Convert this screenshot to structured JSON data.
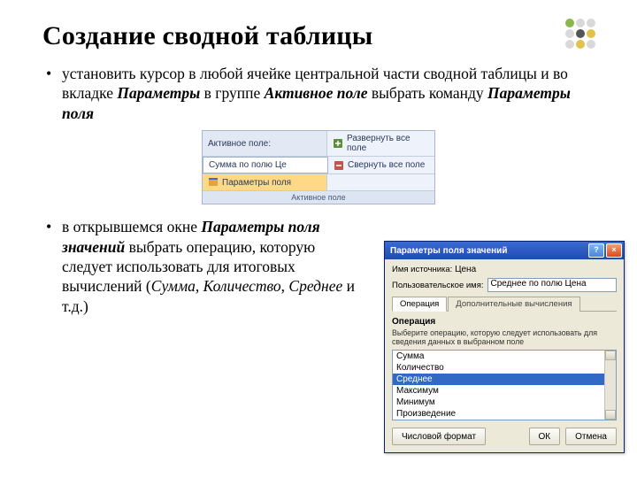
{
  "title": "Создание сводной таблицы",
  "bullet1": {
    "pre": "установить курсор в любой ячейке центральной части сводной таблицы и во вкладке ",
    "t1": "Параметры",
    "mid": " в группе ",
    "t2": "Активное поле",
    "mid2": " выбрать команду ",
    "t3": "Параметры поля"
  },
  "ribbon": {
    "r1_left": "Активное поле:",
    "r1_right": "Развернуть все поле",
    "r2_left": "Сумма по полю Це",
    "r2_right": "Свернуть все поле",
    "r3_left": "Параметры поля",
    "group": "Активное поле"
  },
  "bullet2": {
    "pre": "в открывшемся окне ",
    "t1": "Параметры поля значений",
    "mid": " выбрать операцию, которую следует использовать для итоговых вычислений (",
    "ex1": "Сумма",
    "c1": ", ",
    "ex2": "Количество",
    "c2": ", ",
    "ex3": "Среднее",
    "tail": " и т.д.)"
  },
  "dialog": {
    "title": "Параметры поля значений",
    "src_label": "Имя источника:",
    "src_value": "Цена",
    "name_label": "Пользовательское имя:",
    "name_value": "Среднее по полю Цена",
    "tab1": "Операция",
    "tab2": "Дополнительные вычисления",
    "group": "Операция",
    "help": "Выберите операцию, которую следует использовать для сведения данных в выбранном поле",
    "options": [
      "Сумма",
      "Количество",
      "Среднее",
      "Максимум",
      "Минимум",
      "Произведение"
    ],
    "selected_index": 2,
    "fmt_btn": "Числовой формат",
    "ok": "ОК",
    "cancel": "Отмена"
  }
}
